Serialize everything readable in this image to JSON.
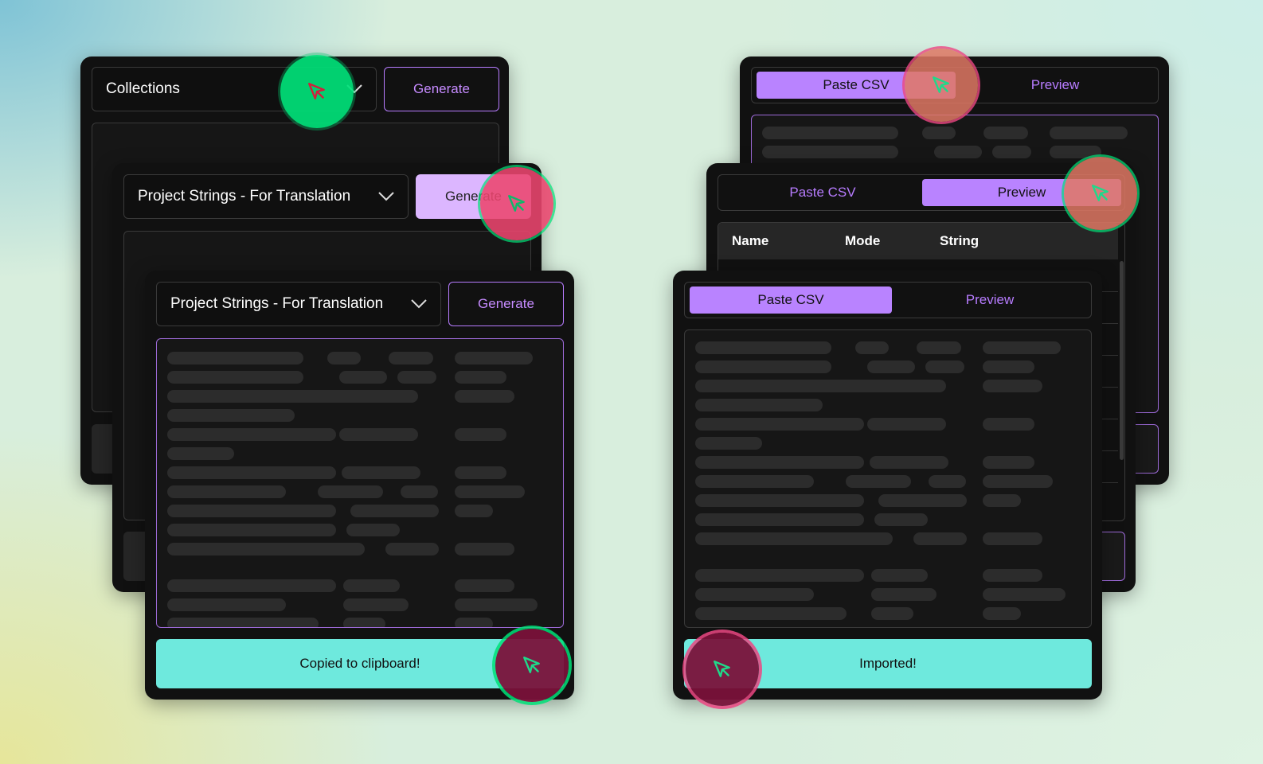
{
  "left": {
    "card_back": {
      "select_value": "Collections",
      "generate_label": "Generate"
    },
    "card_mid": {
      "select_value": "Project Strings - For Translation",
      "generate_label": "Generate"
    },
    "card_front": {
      "select_value": "Project Strings - For Translation",
      "generate_label": "Generate",
      "status": "Copied to clipboard!"
    }
  },
  "right": {
    "card_back": {
      "tab_paste": "Paste CSV",
      "tab_preview": "Preview",
      "active_tab": "Paste CSV"
    },
    "card_mid": {
      "tab_paste": "Paste CSV",
      "tab_preview": "Preview",
      "active_tab": "Preview",
      "table_headers": [
        "Name",
        "Mode",
        "String"
      ]
    },
    "card_front": {
      "tab_paste": "Paste CSV",
      "tab_preview": "Preview",
      "active_tab": "Paste CSV",
      "status": "Imported!"
    }
  },
  "icons": {
    "cursor": "cursor-arrow-icon",
    "chevron": "chevron-down-icon"
  },
  "colors": {
    "card_bg": "#111111",
    "accent_purple": "#b983ff",
    "status_teal": "#6ee9dd",
    "click_green": "#00e178",
    "click_red": "#ec466e",
    "click_maroon": "#7a123a"
  }
}
